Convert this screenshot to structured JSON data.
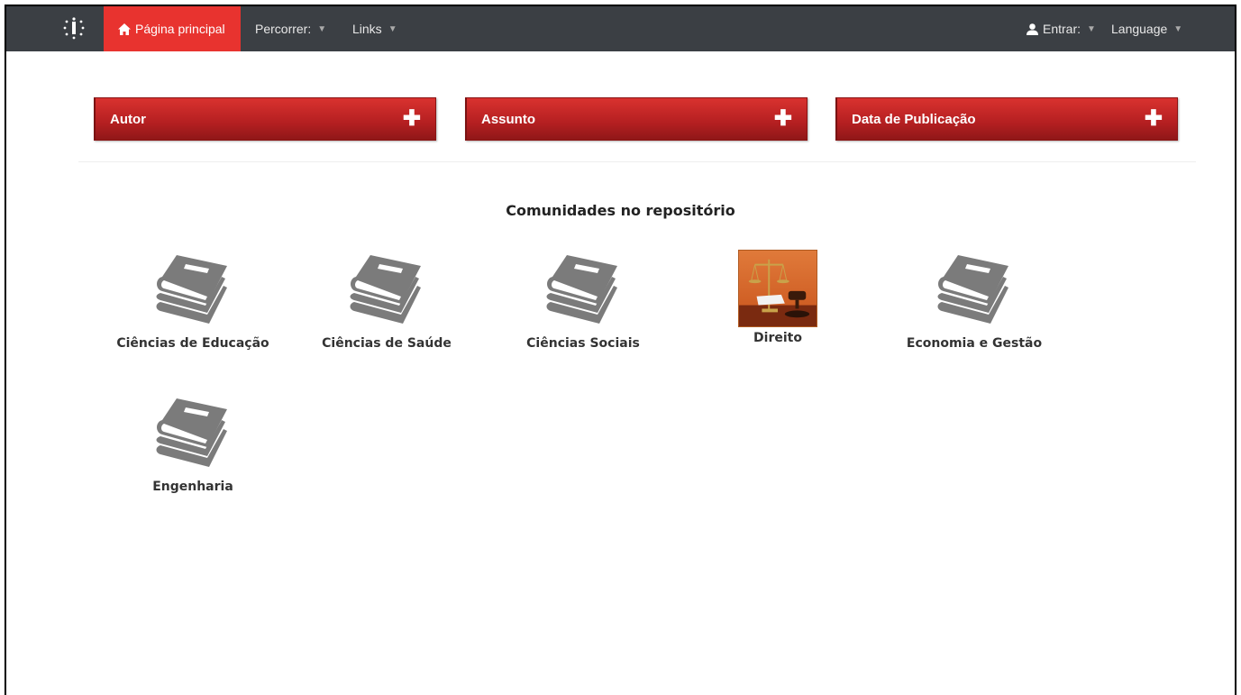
{
  "navbar": {
    "home_label": "Página principal",
    "browse_label": "Percorrer:",
    "links_label": "Links",
    "login_label": "Entrar:",
    "language_label": "Language",
    "bg_color": "#3b3f44",
    "accent_color": "#e8332f"
  },
  "facets": [
    {
      "label": "Autor",
      "icon": "plus-icon"
    },
    {
      "label": "Assunto",
      "icon": "plus-icon"
    },
    {
      "label": "Data de Publicação",
      "icon": "plus-icon"
    }
  ],
  "communities": {
    "title": "Comunidades no repositório",
    "items": [
      {
        "label": "Ciências de Educação",
        "icon": "book-stack-icon"
      },
      {
        "label": "Ciências de Saúde",
        "icon": "book-stack-icon"
      },
      {
        "label": "Ciências Sociais",
        "icon": "book-stack-icon"
      },
      {
        "label": "Direito",
        "icon": "justice-scales-gavel-image"
      },
      {
        "label": "Economia e Gestão",
        "icon": "book-stack-icon"
      },
      {
        "label": "Engenharia",
        "icon": "book-stack-icon"
      }
    ]
  }
}
